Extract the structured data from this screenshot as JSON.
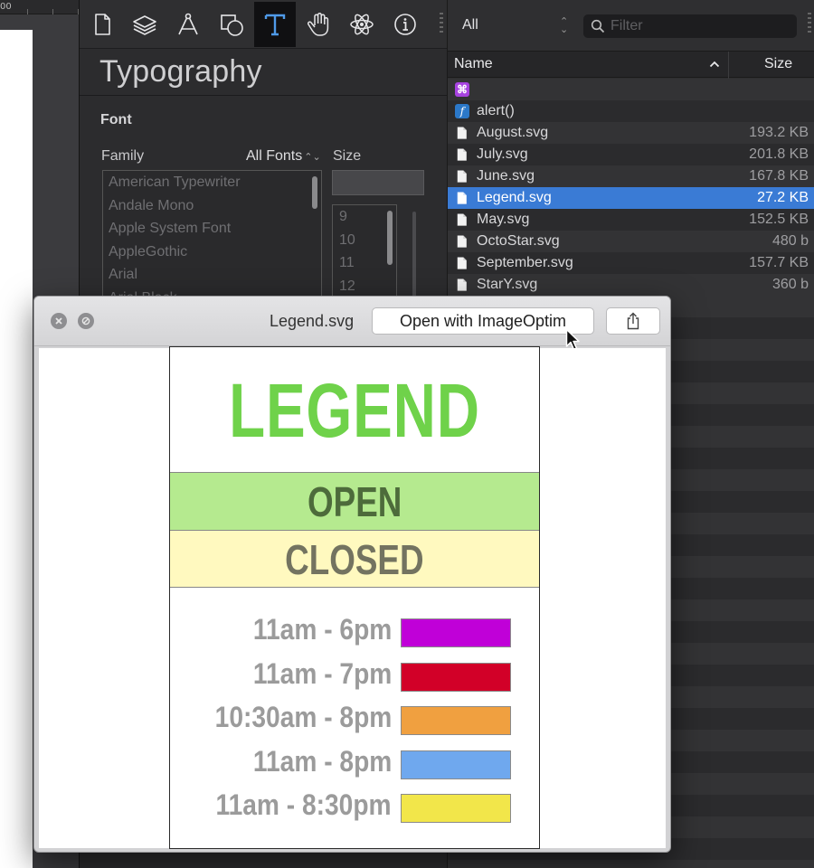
{
  "canvas": {
    "ruler_label": "00"
  },
  "inspector": {
    "tools": [
      {
        "name": "document-icon",
        "active": false
      },
      {
        "name": "layers-icon",
        "active": false
      },
      {
        "name": "pen-tool-icon",
        "active": false
      },
      {
        "name": "shapes-icon",
        "active": false
      },
      {
        "name": "text-tool-icon",
        "active": true
      },
      {
        "name": "hand-icon",
        "active": false
      },
      {
        "name": "atom-icon",
        "active": false
      },
      {
        "name": "info-icon",
        "active": false
      }
    ],
    "title": "Typography",
    "section": "Font",
    "family_label": "Family",
    "font_set": "All Fonts",
    "size_label": "Size",
    "size_value": "",
    "families": [
      "American Typewriter",
      "Andale Mono",
      "Apple System Font",
      "AppleGothic",
      "Arial",
      "Arial Black"
    ],
    "sizes": [
      "9",
      "10",
      "11",
      "12"
    ]
  },
  "browser": {
    "filter_scope": "All",
    "filter_placeholder": "Filter",
    "columns": {
      "name": "Name",
      "size": "Size"
    },
    "rows": [
      {
        "type": "plugin",
        "name": "",
        "size": "",
        "selected": false
      },
      {
        "type": "function",
        "name": "alert()",
        "size": "",
        "selected": false
      },
      {
        "type": "file",
        "name": "August.svg",
        "size": "193.2 KB",
        "selected": false
      },
      {
        "type": "file",
        "name": "July.svg",
        "size": "201.8 KB",
        "selected": false
      },
      {
        "type": "file",
        "name": "June.svg",
        "size": "167.8 KB",
        "selected": false
      },
      {
        "type": "file",
        "name": "Legend.svg",
        "size": "27.2 KB",
        "selected": true
      },
      {
        "type": "file",
        "name": "May.svg",
        "size": "152.5 KB",
        "selected": false
      },
      {
        "type": "file",
        "name": "OctoStar.svg",
        "size": "480 b",
        "selected": false
      },
      {
        "type": "file",
        "name": "September.svg",
        "size": "157.7 KB",
        "selected": false
      },
      {
        "type": "file",
        "name": "StarY.svg",
        "size": "360 b",
        "selected": false
      }
    ]
  },
  "quicklook": {
    "filename": "Legend.svg",
    "open_with_label": "Open with ImageOptim",
    "document": {
      "title": "LEGEND",
      "title_color": "#6fd24a",
      "open_label": "OPEN",
      "open_bg": "#b5ea8f",
      "closed_label": "CLOSED",
      "closed_bg": "#fff9bf",
      "hours": [
        {
          "label": "11am - 6pm",
          "color": "#c000d8"
        },
        {
          "label": "11am - 7pm",
          "color": "#d20028"
        },
        {
          "label": "10:30am - 8pm",
          "color": "#f0a040"
        },
        {
          "label": "11am - 8pm",
          "color": "#6fa8ee"
        },
        {
          "label": "11am - 8:30pm",
          "color": "#f2e64a"
        }
      ]
    }
  }
}
